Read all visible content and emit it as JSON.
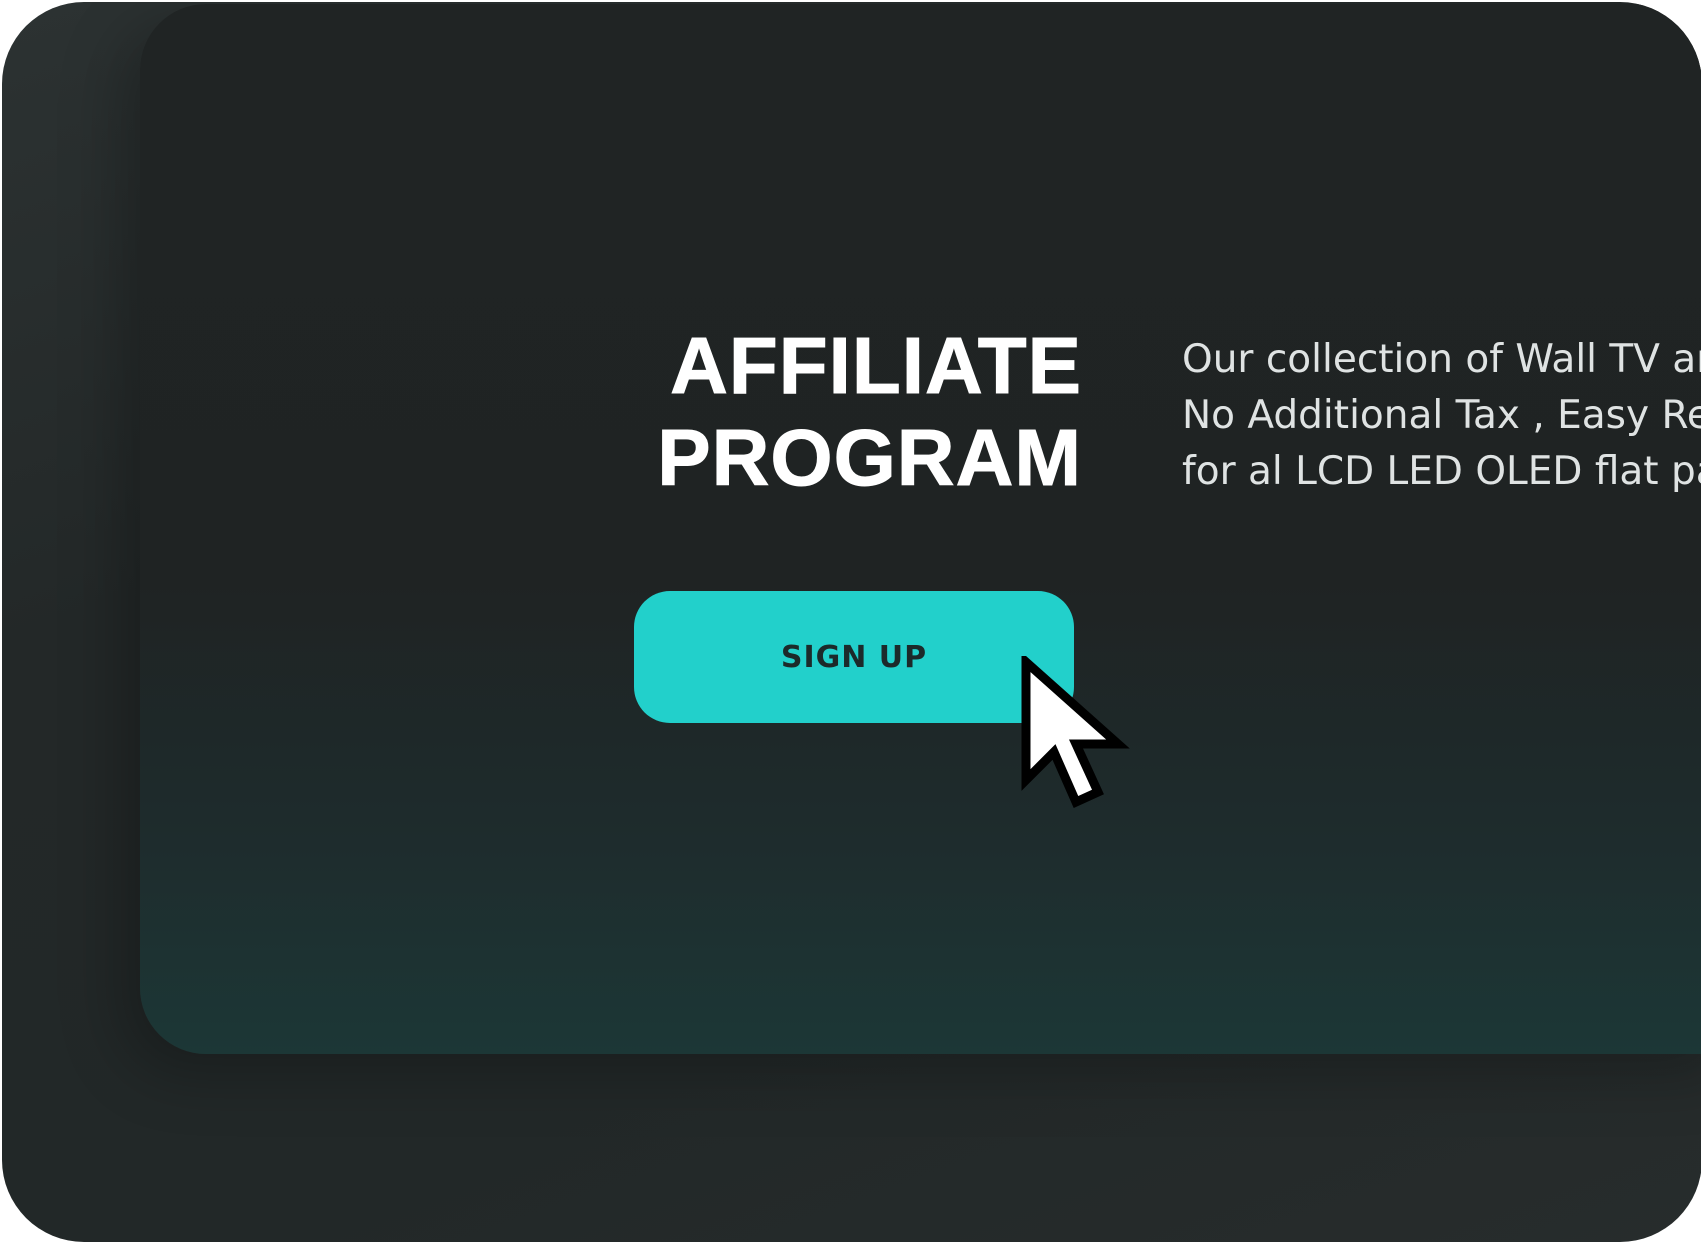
{
  "hero": {
    "title_line1": "AFFILIATE",
    "title_line2": "PROGRAM",
    "description_lines": [
      "Our collection of Wall TV ar",
      "No Additional Tax , Easy Re",
      "for al LCD LED OLED flat pa"
    ],
    "signup_label": "SIGN UP"
  },
  "colors": {
    "background": "#222828",
    "panel": "#1f2323",
    "accent": "#22d0cb",
    "text": "#ffffff"
  },
  "icons": {
    "cursor": "mouse-pointer-icon"
  }
}
